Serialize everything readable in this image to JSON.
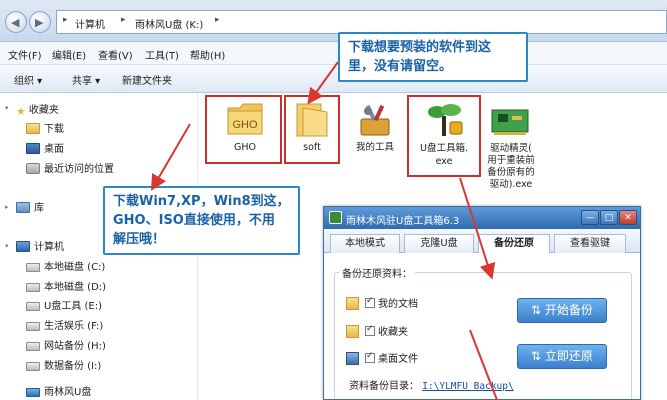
{
  "address": {
    "crumbs": [
      "计算机",
      "雨林风U盘 (K:)"
    ],
    "back_arrow": "◀",
    "forward_arrow": "▶",
    "separator": "▸"
  },
  "menu": [
    "文件(F)",
    "编辑(E)",
    "查看(V)",
    "工具(T)",
    "帮助(H)"
  ],
  "toolbar": {
    "organize": "组织 ▾",
    "share": "共享 ▾",
    "new_folder": "新建文件夹"
  },
  "nav_tree": {
    "favorites": "收藏夹",
    "downloads": "下载",
    "desktop": "桌面",
    "recent": "最近访问的位置",
    "libraries": "库",
    "computer": "计算机",
    "drives": [
      "本地磁盘 (C:)",
      "本地磁盘 (D:)",
      "U盘工具 (E:)",
      "生活娱乐 (F:)",
      "网站备份 (H:)",
      "数据备份 (I:)",
      "雨林风U盘"
    ]
  },
  "files": {
    "gho_badge": "GHO",
    "gho_label": "GHO",
    "soft_label": "soft",
    "my_tools_label": "我的工具",
    "usb_tool_label": [
      "U盘工具箱.",
      "exe"
    ],
    "driver_label": [
      "驱动精灵(",
      "用于重装前",
      "备份原有的",
      "驱动).exe"
    ]
  },
  "callouts": {
    "top_right": [
      "下载想要预装的软件到这",
      "里，没有请留空。"
    ],
    "left": [
      "下载Win7,XP，Win8到这，",
      "GHO、ISO直接使用，不用",
      "解压哦！"
    ]
  },
  "dialog": {
    "title": "雨林木风驻U盘工具箱6.3",
    "min": "—",
    "max": "□",
    "close": "✕",
    "tabs": [
      "本地模式",
      "克隆U盘",
      "备份还原",
      "查看驱键"
    ],
    "active_tab": "备份还原",
    "section_label": "备份还原资料：",
    "items": [
      "我的文档",
      "收藏夹",
      "桌面文件"
    ],
    "start_backup": "开始备份",
    "restore_now": "立即还原",
    "path_label": "资料备份目录：",
    "path_value": "I:\\YLMFU Backup\\"
  },
  "colors": {
    "accent_blue": "#2a88c6",
    "highlight_red": "#c8302c",
    "button_blue": "#3b80cd"
  }
}
